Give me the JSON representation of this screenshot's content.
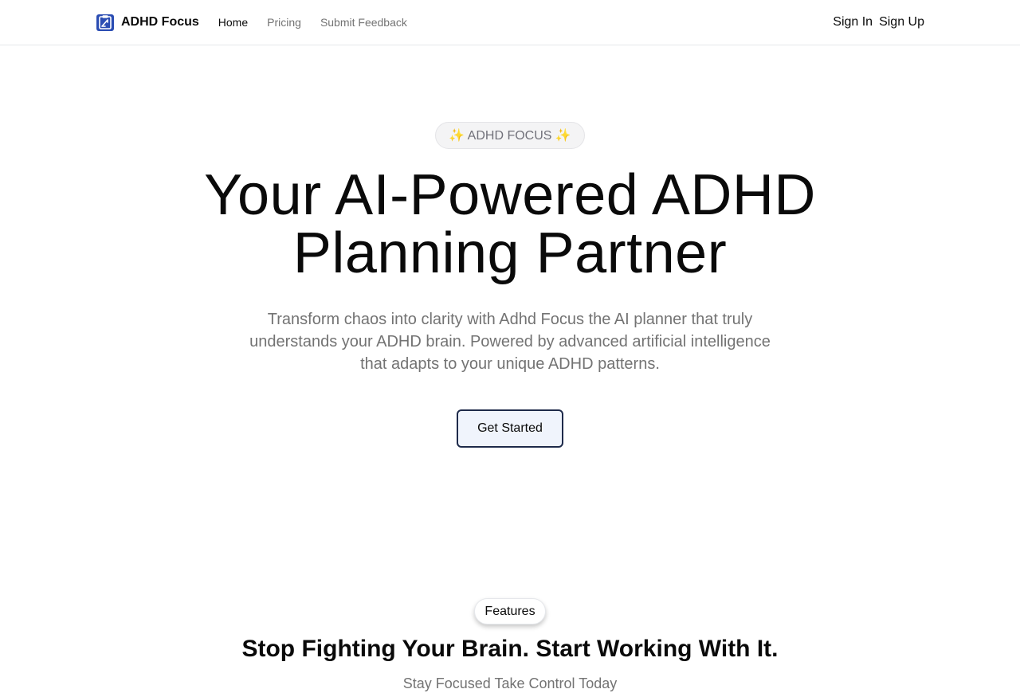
{
  "nav": {
    "brand": "ADHD Focus",
    "links": [
      {
        "label": "Home",
        "active": true
      },
      {
        "label": "Pricing",
        "active": false
      },
      {
        "label": "Submit Feedback",
        "active": false
      }
    ],
    "sign_in": "Sign In",
    "sign_up": "Sign Up"
  },
  "hero": {
    "badge": "✨ ADHD FOCUS ✨",
    "title_line1": "Your AI-Powered ADHD",
    "title_line2": "Planning Partner",
    "subtitle": "Transform chaos into clarity with Adhd Focus the AI planner that truly understands your ADHD brain. Powered by advanced artificial intelligence that adapts to your unique ADHD patterns.",
    "cta": "Get Started"
  },
  "features": {
    "pill": "Features",
    "title": "Stop Fighting Your Brain. Start Working With It.",
    "subtitle": "Stay Focused Take Control Today"
  },
  "colors": {
    "logo_blue": "#2b4db3",
    "cta_border": "#1e2a4a",
    "cta_bg": "#f0f4fc",
    "muted_text": "#737373"
  }
}
